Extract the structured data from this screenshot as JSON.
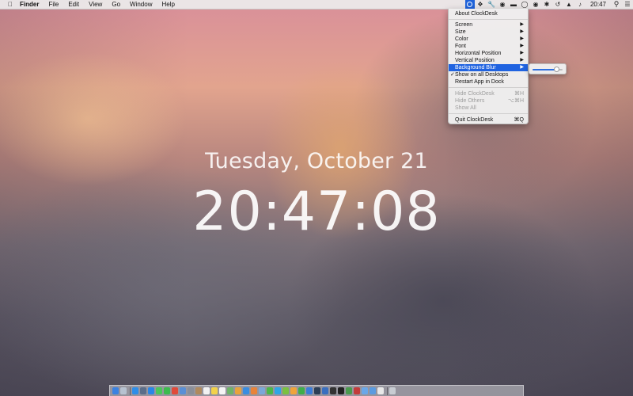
{
  "menubar": {
    "apple_icon": "apple-logo-icon",
    "app_name": "Finder",
    "items": [
      "File",
      "Edit",
      "View",
      "Go",
      "Window",
      "Help"
    ],
    "time": "20:47",
    "status_icons": [
      "clockdesk-icon",
      "dropbox-icon",
      "tools-icon",
      "shield-icon",
      "battery-icon",
      "sync-icon",
      "audio-icon",
      "bluetooth-icon",
      "time-machine-icon",
      "wifi-icon",
      "volume-icon",
      "search-icon",
      "notification-icon"
    ]
  },
  "menu": {
    "items": [
      {
        "label": "About ClockDesk",
        "shortcut": "",
        "submenu": false,
        "disabled": false,
        "checked": false,
        "selected": false
      },
      {
        "label": "Screen",
        "shortcut": "",
        "submenu": true,
        "disabled": false,
        "checked": false,
        "selected": false
      },
      {
        "label": "Size",
        "shortcut": "",
        "submenu": true,
        "disabled": false,
        "checked": false,
        "selected": false
      },
      {
        "label": "Color",
        "shortcut": "",
        "submenu": true,
        "disabled": false,
        "checked": false,
        "selected": false
      },
      {
        "label": "Font",
        "shortcut": "",
        "submenu": true,
        "disabled": false,
        "checked": false,
        "selected": false
      },
      {
        "label": "Horizontal Position",
        "shortcut": "",
        "submenu": true,
        "disabled": false,
        "checked": false,
        "selected": false
      },
      {
        "label": "Vertical Position",
        "shortcut": "",
        "submenu": true,
        "disabled": false,
        "checked": false,
        "selected": false
      },
      {
        "label": "Background Blur",
        "shortcut": "",
        "submenu": true,
        "disabled": false,
        "checked": false,
        "selected": true
      },
      {
        "label": "Show on all Desktops",
        "shortcut": "",
        "submenu": false,
        "disabled": false,
        "checked": true,
        "selected": false
      },
      {
        "label": "Restart App in Dock",
        "shortcut": "",
        "submenu": false,
        "disabled": false,
        "checked": false,
        "selected": false
      },
      {
        "label": "Hide ClockDesk",
        "shortcut": "⌘H",
        "submenu": false,
        "disabled": true,
        "checked": false,
        "selected": false
      },
      {
        "label": "Hide Others",
        "shortcut": "⌥⌘H",
        "submenu": false,
        "disabled": true,
        "checked": false,
        "selected": false
      },
      {
        "label": "Show All",
        "shortcut": "",
        "submenu": false,
        "disabled": true,
        "checked": false,
        "selected": false
      },
      {
        "label": "Quit ClockDesk",
        "shortcut": "⌘Q",
        "submenu": false,
        "disabled": false,
        "checked": false,
        "selected": false
      }
    ],
    "submenu_arrow": "▶",
    "check_mark": "✓"
  },
  "blur_slider": {
    "value": 0.78
  },
  "clock": {
    "date": "Tuesday, October 21",
    "time": "20:47:08"
  },
  "dock": {
    "icons": [
      {
        "name": "finder-icon",
        "color": "#3b82e0"
      },
      {
        "name": "launchpad-icon",
        "color": "#b7c2d0"
      },
      {
        "name": "safari-icon",
        "color": "#2f8ee8"
      },
      {
        "name": "mission-control-icon",
        "color": "#5b6e8a"
      },
      {
        "name": "app-store-icon",
        "color": "#2a86e6"
      },
      {
        "name": "messages-icon",
        "color": "#4cc65a"
      },
      {
        "name": "facetime-icon",
        "color": "#3dbb4e"
      },
      {
        "name": "chrome-icon",
        "color": "#e04a3a"
      },
      {
        "name": "mail-icon",
        "color": "#5a8fd6"
      },
      {
        "name": "system-preferences-icon",
        "color": "#8a8f99"
      },
      {
        "name": "contacts-icon",
        "color": "#b08a5e"
      },
      {
        "name": "calendar-icon",
        "color": "#f2f2f2"
      },
      {
        "name": "notes-icon",
        "color": "#f3d24a"
      },
      {
        "name": "reminders-icon",
        "color": "#f5f5f5"
      },
      {
        "name": "maps-icon",
        "color": "#6fb36a"
      },
      {
        "name": "photos-icon",
        "color": "#e8a33d"
      },
      {
        "name": "itunes-icon",
        "color": "#3a8de0"
      },
      {
        "name": "ibooks-icon",
        "color": "#e8833a"
      },
      {
        "name": "preview-icon",
        "color": "#7aa8d8"
      },
      {
        "name": "evernote-icon",
        "color": "#4cb748"
      },
      {
        "name": "skype-icon",
        "color": "#2ea6e6"
      },
      {
        "name": "spotify-icon",
        "color": "#7ac142"
      },
      {
        "name": "pages-icon",
        "color": "#f0a43a"
      },
      {
        "name": "numbers-icon",
        "color": "#3fae4a"
      },
      {
        "name": "keynote-icon",
        "color": "#3b7dd8"
      },
      {
        "name": "steam-icon",
        "color": "#2c3e55"
      },
      {
        "name": "xcode-icon",
        "color": "#3a6fbf"
      },
      {
        "name": "console-icon",
        "color": "#333333"
      },
      {
        "name": "terminal-icon",
        "color": "#222222"
      },
      {
        "name": "activity-monitor-icon",
        "color": "#4a9a4e"
      },
      {
        "name": "photo-booth-icon",
        "color": "#c23b3b"
      },
      {
        "name": "folder-icon",
        "color": "#6aa7e8"
      },
      {
        "name": "downloads-icon",
        "color": "#5b9be0"
      },
      {
        "name": "documents-icon",
        "color": "#e8e8e8"
      },
      {
        "name": "trash-icon",
        "color": "#c8ccd2"
      }
    ],
    "separator_after": [
      1,
      33
    ]
  }
}
